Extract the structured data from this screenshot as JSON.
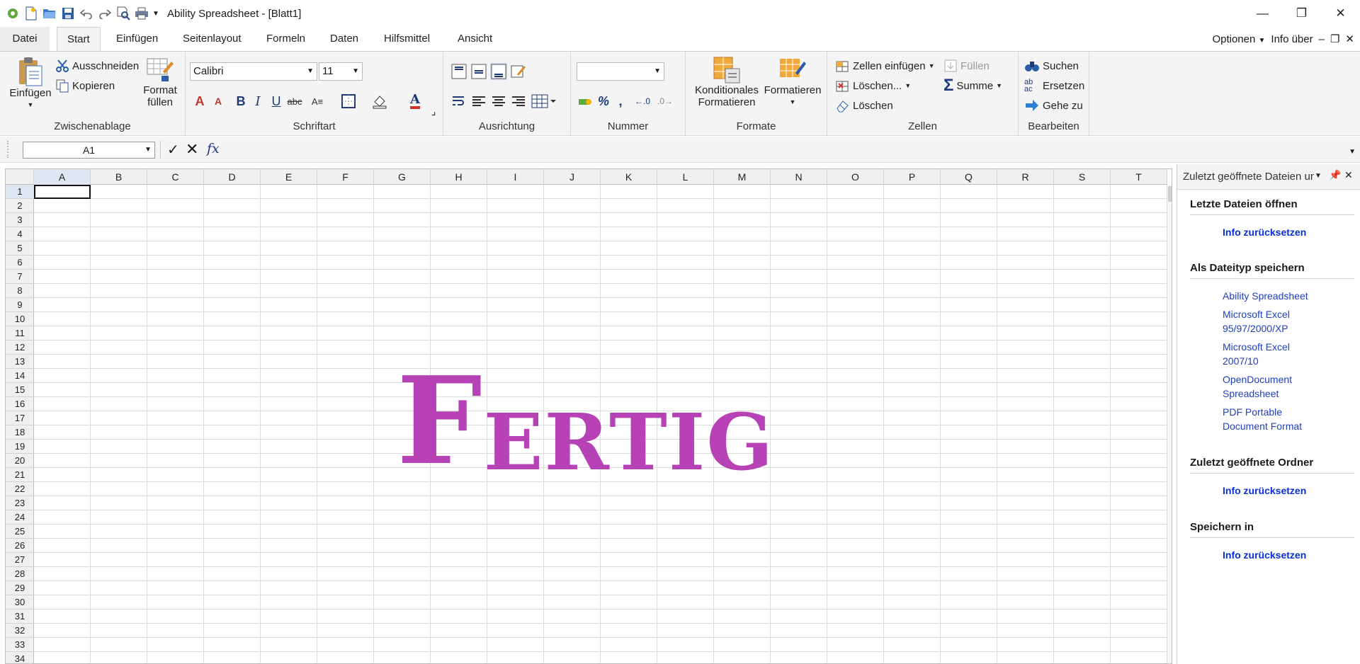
{
  "window": {
    "title": "Ability Spreadsheet - [Blatt1]",
    "controls": [
      "minimize-icon",
      "restore-icon",
      "close-icon"
    ]
  },
  "tabs": {
    "file": "Datei",
    "items": [
      "Start",
      "Einfügen",
      "Seitenlayout",
      "Formeln",
      "Daten",
      "Hilfsmittel",
      "Ansicht"
    ],
    "active": "Start",
    "right": {
      "options": "Optionen",
      "info": "Info über"
    }
  },
  "ribbon": {
    "clipboard": {
      "label": "Zwischenablage",
      "paste": "Einfügen",
      "cut": "Ausschneiden",
      "copy": "Kopieren",
      "format_fill_1": "Format",
      "format_fill_2": "füllen"
    },
    "font": {
      "label": "Schriftart",
      "family": "Calibri",
      "size": "11"
    },
    "alignment": {
      "label": "Ausrichtung"
    },
    "number": {
      "label": "Nummer",
      "format_value": ""
    },
    "formats": {
      "label": "Formate",
      "conditional_1": "Konditionales",
      "conditional_2": "Formatieren",
      "format": "Formatieren"
    },
    "cells": {
      "label": "Zellen",
      "insert": "Zellen einfügen",
      "delete_menu": "Löschen...",
      "delete": "Löschen",
      "fill": "Füllen",
      "sum": "Summe"
    },
    "edit": {
      "label": "Bearbeiten",
      "find": "Suchen",
      "replace": "Ersetzen",
      "goto": "Gehe zu"
    }
  },
  "formula_bar": {
    "cell_ref": "A1",
    "content": ""
  },
  "grid": {
    "columns": [
      "A",
      "B",
      "C",
      "D",
      "E",
      "F",
      "G",
      "H",
      "I",
      "J",
      "K",
      "L",
      "M",
      "N",
      "O",
      "P",
      "Q",
      "R",
      "S",
      "T"
    ],
    "rows": [
      "1",
      "2",
      "3",
      "4",
      "5",
      "6",
      "7",
      "8",
      "9",
      "10",
      "11",
      "12",
      "13",
      "14",
      "15",
      "16",
      "17",
      "18",
      "19",
      "20",
      "21",
      "22",
      "23",
      "24",
      "25",
      "26",
      "27",
      "28",
      "29",
      "30",
      "31",
      "32",
      "33",
      "34"
    ],
    "active_cell": "A1",
    "overlay_first": "F",
    "overlay_rest": "ERTIG",
    "overlay_color": "#b642b6"
  },
  "side_panel": {
    "title": "Zuletzt geöffnete Dateien und Ordner",
    "recent_files_heading": "Letzte Dateien öffnen",
    "recent_files_reset": "Info zurücksetzen",
    "save_as_heading": "Als Dateityp speichern",
    "save_as_types": [
      "Ability Spreadsheet",
      "Microsoft Excel 95/97/2000/XP",
      "Microsoft Excel 2007/10",
      "OpenDocument Spreadsheet",
      "PDF Portable Document Format"
    ],
    "recent_folders_heading": "Zuletzt geöffnete Ordner",
    "recent_folders_reset": "Info zurücksetzen",
    "save_in_heading": "Speichern in",
    "save_in_reset": "Info zurücksetzen"
  }
}
